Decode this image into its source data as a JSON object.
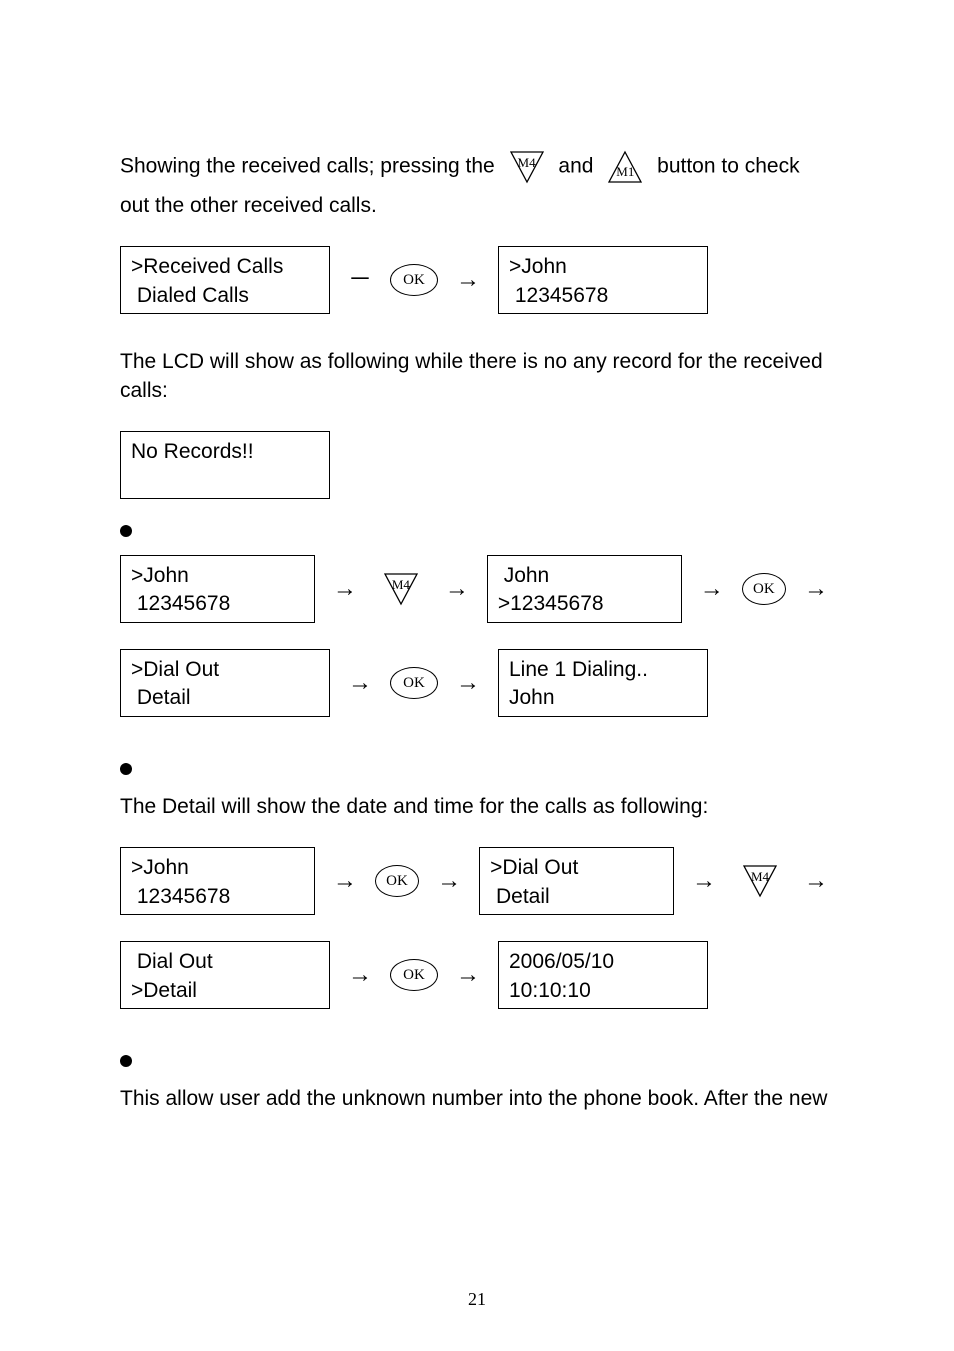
{
  "intro": {
    "line1_a": "Showing the received calls; pressing the",
    "line1_and": "and",
    "line1_b": "button to check",
    "line2": "out the other received calls."
  },
  "icons": {
    "m4": "M4",
    "m1": "M1",
    "ok": "OK"
  },
  "flow1": {
    "box1_l1": ">Received Calls",
    "box1_l2": " Dialed Calls",
    "dash": "－",
    "arrow": "→",
    "box2_l1": ">John",
    "box2_l2": " 12345678"
  },
  "lcd_no_record_intro": "The LCD will show as following while there is no any record for the received calls:",
  "no_records_box": "No Records!!",
  "flow2": {
    "r1_box1_l1": ">John",
    "r1_box1_l2": " 12345678",
    "r1_box2_l1": " John",
    "r1_box2_l2": ">12345678",
    "r2_box1_l1": ">Dial Out",
    "r2_box1_l2": " Detail",
    "r2_box2_l1": "Line 1 Dialing..",
    "r2_box2_l2": "John",
    "arrow": "→"
  },
  "detail_intro": "The Detail will show the date and time for the calls as following:",
  "flow3": {
    "r1_box1_l1": ">John",
    "r1_box1_l2": " 12345678",
    "r1_box2_l1": ">Dial Out",
    "r1_box2_l2": " Detail",
    "r2_box1_l1": " Dial Out",
    "r2_box1_l2": ">Detail",
    "r2_box2_l1": "2006/05/10",
    "r2_box2_l2": "10:10:10",
    "arrow": "→"
  },
  "outro": "This allow user add the unknown number into the phone book. After the new",
  "page_number": "21"
}
